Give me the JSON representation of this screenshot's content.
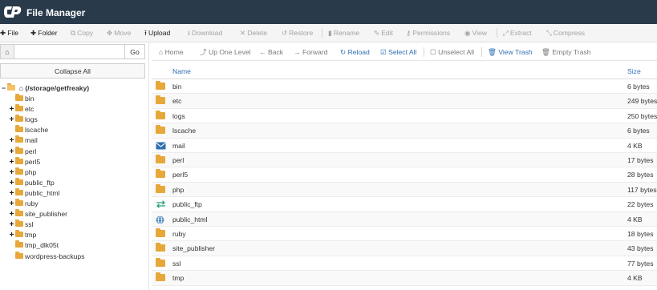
{
  "app": {
    "title": "File Manager"
  },
  "toolbar": {
    "file": "File",
    "folder": "Folder",
    "copy": "Copy",
    "move": "Move",
    "upload": "Upload",
    "download": "Download",
    "delete": "Delete",
    "restore": "Restore",
    "rename": "Rename",
    "edit": "Edit",
    "permissions": "Permissions",
    "view": "View",
    "extract": "Extract",
    "compress": "Compress"
  },
  "search": {
    "value": "",
    "placeholder": "",
    "go": "Go"
  },
  "tree": {
    "collapse_all": "Collapse All",
    "root": "(/storage/getfreaky)",
    "items": [
      {
        "label": "bin",
        "expandable": false
      },
      {
        "label": "etc",
        "expandable": true
      },
      {
        "label": "logs",
        "expandable": true
      },
      {
        "label": "lscache",
        "expandable": false
      },
      {
        "label": "mail",
        "expandable": true
      },
      {
        "label": "perl",
        "expandable": true
      },
      {
        "label": "perl5",
        "expandable": true
      },
      {
        "label": "php",
        "expandable": true
      },
      {
        "label": "public_ftp",
        "expandable": true
      },
      {
        "label": "public_html",
        "expandable": true
      },
      {
        "label": "ruby",
        "expandable": true
      },
      {
        "label": "site_publisher",
        "expandable": true
      },
      {
        "label": "ssl",
        "expandable": true
      },
      {
        "label": "tmp",
        "expandable": true
      },
      {
        "label": "tmp_dlk05t",
        "expandable": false
      },
      {
        "label": "wordpress-backups",
        "expandable": false
      }
    ]
  },
  "nav": {
    "home": "Home",
    "up": "Up One Level",
    "back": "Back",
    "forward": "Forward",
    "reload": "Reload",
    "select_all": "Select All",
    "unselect_all": "Unselect All",
    "view_trash": "View Trash",
    "empty_trash": "Empty Trash"
  },
  "table": {
    "headers": {
      "name": "Name",
      "size": "Size"
    },
    "rows": [
      {
        "name": "bin",
        "size": "6 bytes",
        "icon": "folder-icon"
      },
      {
        "name": "etc",
        "size": "249 bytes",
        "icon": "folder-icon"
      },
      {
        "name": "logs",
        "size": "250 bytes",
        "icon": "folder-icon"
      },
      {
        "name": "lscache",
        "size": "6 bytes",
        "icon": "folder-icon"
      },
      {
        "name": "mail",
        "size": "4 KB",
        "icon": "mail-icon"
      },
      {
        "name": "perl",
        "size": "17 bytes",
        "icon": "folder-icon"
      },
      {
        "name": "perl5",
        "size": "28 bytes",
        "icon": "folder-icon"
      },
      {
        "name": "php",
        "size": "117 bytes",
        "icon": "folder-icon"
      },
      {
        "name": "public_ftp",
        "size": "22 bytes",
        "icon": "ftp-arrows-icon"
      },
      {
        "name": "public_html",
        "size": "4 KB",
        "icon": "globe-icon"
      },
      {
        "name": "ruby",
        "size": "18 bytes",
        "icon": "folder-icon"
      },
      {
        "name": "site_publisher",
        "size": "43 bytes",
        "icon": "folder-icon"
      },
      {
        "name": "ssl",
        "size": "77 bytes",
        "icon": "folder-icon"
      },
      {
        "name": "tmp",
        "size": "4 KB",
        "icon": "folder-icon"
      }
    ]
  },
  "colors": {
    "topbar": "#293a4a",
    "link": "#2f6fb3",
    "folder": "#e7a83a"
  }
}
